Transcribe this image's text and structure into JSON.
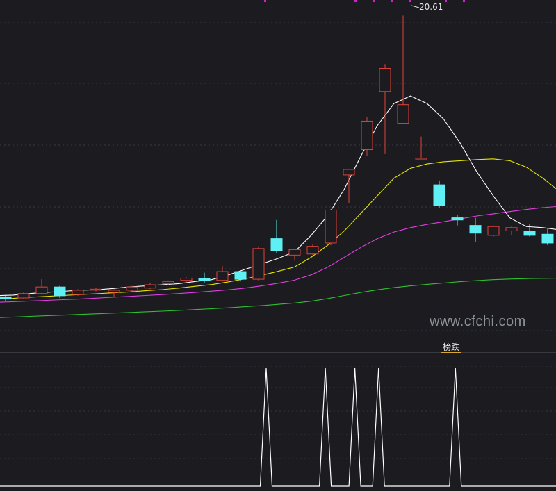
{
  "chart_data": [
    {
      "type": "candlestick",
      "title": "",
      "ylim": [
        6.2,
        21.0
      ],
      "peak_label": "20.61",
      "colors": {
        "up": "#e0423a",
        "down": "#5ef0f5",
        "ma5": "#ffffff",
        "ma10": "#e6e600",
        "ma20": "#e040e0",
        "ma60": "#30c030"
      },
      "candles": [
        {
          "o": 7.8,
          "h": 7.9,
          "l": 7.62,
          "c": 7.7
        },
        {
          "o": 7.75,
          "h": 8.0,
          "l": 7.7,
          "c": 7.95
        },
        {
          "o": 7.95,
          "h": 8.6,
          "l": 7.9,
          "c": 8.25
        },
        {
          "o": 8.25,
          "h": 8.3,
          "l": 7.75,
          "c": 7.85
        },
        {
          "o": 7.9,
          "h": 8.15,
          "l": 7.85,
          "c": 8.1
        },
        {
          "o": 8.15,
          "h": 8.22,
          "l": 8.05,
          "c": 8.15
        },
        {
          "o": 8.0,
          "h": 8.15,
          "l": 7.8,
          "c": 8.1
        },
        {
          "o": 8.1,
          "h": 8.3,
          "l": 8.05,
          "c": 8.25
        },
        {
          "o": 8.2,
          "h": 8.45,
          "l": 8.15,
          "c": 8.35
        },
        {
          "o": 8.4,
          "h": 8.55,
          "l": 8.35,
          "c": 8.5
        },
        {
          "o": 8.55,
          "h": 8.7,
          "l": 8.45,
          "c": 8.65
        },
        {
          "o": 8.65,
          "h": 8.9,
          "l": 8.45,
          "c": 8.55
        },
        {
          "o": 8.55,
          "h": 9.2,
          "l": 8.55,
          "c": 8.95
        },
        {
          "o": 8.95,
          "h": 8.95,
          "l": 8.5,
          "c": 8.6
        },
        {
          "o": 8.6,
          "h": 10.1,
          "l": 8.55,
          "c": 10.0
        },
        {
          "o": 10.45,
          "h": 11.3,
          "l": 9.8,
          "c": 9.9
        },
        {
          "o": 9.7,
          "h": 9.95,
          "l": 9.45,
          "c": 9.95
        },
        {
          "o": 9.75,
          "h": 10.2,
          "l": 9.7,
          "c": 10.1
        },
        {
          "o": 10.25,
          "h": 11.8,
          "l": 10.15,
          "c": 11.75
        },
        {
          "o": 13.35,
          "h": 13.5,
          "l": 12.05,
          "c": 13.6
        },
        {
          "o": 14.5,
          "h": 16.0,
          "l": 14.2,
          "c": 15.8
        },
        {
          "o": 17.15,
          "h": 18.4,
          "l": 14.3,
          "c": 18.2
        },
        {
          "o": 15.7,
          "h": 20.61,
          "l": 15.7,
          "c": 16.55
        },
        {
          "o": 14.1,
          "h": 15.1,
          "l": 14.1,
          "c": 14.12
        },
        {
          "o": 12.9,
          "h": 13.1,
          "l": 11.85,
          "c": 11.95
        },
        {
          "o": 11.4,
          "h": 11.55,
          "l": 11.05,
          "c": 11.3
        },
        {
          "o": 11.05,
          "h": 11.4,
          "l": 10.3,
          "c": 10.7
        },
        {
          "o": 10.6,
          "h": 11.05,
          "l": 10.55,
          "c": 11.0
        },
        {
          "o": 10.8,
          "h": 11.0,
          "l": 10.6,
          "c": 10.95
        },
        {
          "o": 10.8,
          "h": 11.1,
          "l": 10.55,
          "c": 10.6
        },
        {
          "o": 10.65,
          "h": 10.9,
          "l": 10.15,
          "c": 10.25
        }
      ],
      "ma": {
        "ma5": [
          7.85,
          7.88,
          7.95,
          8.0,
          8.05,
          8.1,
          8.12,
          8.18,
          8.25,
          8.3,
          8.35,
          8.4,
          8.5,
          8.58,
          8.8,
          9.05,
          9.3,
          9.55,
          9.85,
          10.6,
          11.5,
          12.7,
          14.2,
          15.6,
          16.6,
          16.95,
          16.6,
          15.9,
          14.8,
          13.5,
          12.4,
          11.4,
          11.0,
          10.95,
          10.85
        ],
        "ma10": [
          7.7,
          7.73,
          7.78,
          7.82,
          7.86,
          7.9,
          7.94,
          7.98,
          8.02,
          8.08,
          8.13,
          8.2,
          8.28,
          8.36,
          8.48,
          8.62,
          8.78,
          8.96,
          9.16,
          9.6,
          10.15,
          10.8,
          11.6,
          12.4,
          13.2,
          13.65,
          13.85,
          13.95,
          14.0,
          14.05,
          14.08,
          14.0,
          13.7,
          13.2,
          12.6
        ],
        "ma20": [
          7.55,
          7.58,
          7.61,
          7.64,
          7.67,
          7.7,
          7.74,
          7.78,
          7.82,
          7.86,
          7.9,
          7.95,
          8.0,
          8.06,
          8.12,
          8.2,
          8.3,
          8.42,
          8.56,
          8.8,
          9.15,
          9.6,
          10.05,
          10.45,
          10.75,
          10.95,
          11.1,
          11.22,
          11.35,
          11.48,
          11.58,
          11.68,
          11.78,
          11.86,
          11.92
        ],
        "ma60": [
          6.85,
          6.88,
          6.91,
          6.94,
          6.97,
          7.0,
          7.03,
          7.06,
          7.09,
          7.12,
          7.15,
          7.18,
          7.22,
          7.26,
          7.3,
          7.35,
          7.4,
          7.46,
          7.52,
          7.6,
          7.72,
          7.86,
          8.0,
          8.12,
          8.22,
          8.3,
          8.37,
          8.43,
          8.49,
          8.54,
          8.58,
          8.61,
          8.63,
          8.64,
          8.65
        ]
      }
    },
    {
      "type": "line",
      "label": "榜跌",
      "values": [
        0,
        0,
        0,
        0,
        0,
        0,
        0,
        0,
        0,
        0,
        0,
        0,
        0,
        0,
        0,
        0,
        0,
        0,
        0,
        0,
        0,
        0,
        0,
        0,
        0,
        0,
        0,
        0,
        0,
        0,
        0,
        0,
        0,
        0,
        0,
        0,
        0,
        0,
        0,
        0,
        0,
        0,
        0,
        0,
        0,
        1,
        0,
        0,
        0,
        0,
        0,
        0,
        0,
        0,
        0,
        1,
        0,
        0,
        0,
        0,
        1,
        0,
        0,
        0,
        1,
        0,
        0,
        0,
        0,
        0,
        0,
        0,
        0,
        0,
        0,
        0,
        0,
        1,
        0,
        0,
        0,
        0,
        0,
        0,
        0,
        0,
        0,
        0,
        0,
        0,
        0,
        0,
        0,
        0,
        0
      ]
    }
  ],
  "watermark": "www.cfchi.com",
  "signal_label": "榜跌"
}
